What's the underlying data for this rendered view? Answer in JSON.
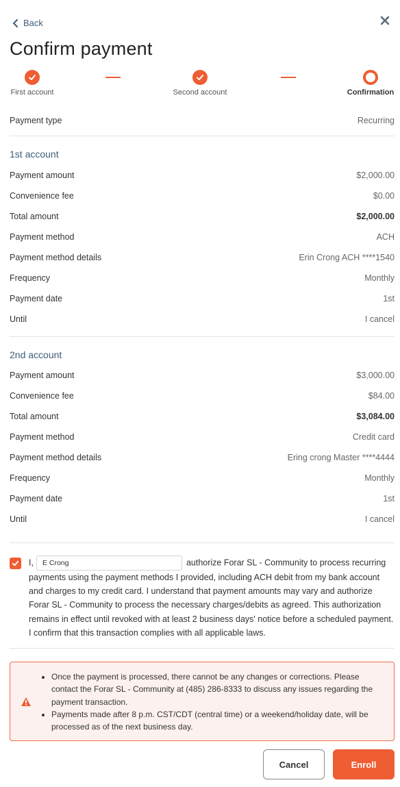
{
  "nav": {
    "back_label": "Back"
  },
  "page_title": "Confirm payment",
  "steps": [
    {
      "label": "First account"
    },
    {
      "label": "Second account"
    },
    {
      "label": "Confirmation"
    }
  ],
  "payment_type": {
    "label": "Payment type",
    "value": "Recurring"
  },
  "accounts": [
    {
      "title": "1st account",
      "rows": [
        {
          "label": "Payment amount",
          "value": "$2,000.00"
        },
        {
          "label": "Convenience fee",
          "value": "$0.00"
        },
        {
          "label": "Total amount",
          "value": "$2,000.00"
        },
        {
          "label": "Payment method",
          "value": "ACH"
        },
        {
          "label": "Payment method details",
          "value": "Erin Crong ACH ****1540"
        },
        {
          "label": "Frequency",
          "value": "Monthly"
        },
        {
          "label": "Payment date",
          "value": "1st"
        },
        {
          "label": "Until",
          "value": "I cancel"
        }
      ]
    },
    {
      "title": "2nd account",
      "rows": [
        {
          "label": "Payment amount",
          "value": "$3,000.00"
        },
        {
          "label": "Convenience fee",
          "value": "$84.00"
        },
        {
          "label": "Total amount",
          "value": "$3,084.00"
        },
        {
          "label": "Payment method",
          "value": "Credit card"
        },
        {
          "label": "Payment method details",
          "value": "Ering crong Master ****4444"
        },
        {
          "label": "Frequency",
          "value": "Monthly"
        },
        {
          "label": "Payment date",
          "value": "1st"
        },
        {
          "label": "Until",
          "value": "I cancel"
        }
      ]
    }
  ],
  "consent": {
    "checked": true,
    "prefix": "I,",
    "name_value": "E Crong",
    "text": "authorize Forar SL - Community to process recurring payments using the payment methods I provided, including ACH debit from my bank account and charges to my credit card. I understand that payment amounts may vary and authorize Forar SL - Community to process the necessary charges/debits as agreed. This authorization remains in effect until revoked with at least 2 business days' notice before a scheduled payment. I confirm that this transaction complies with all applicable laws."
  },
  "alert": {
    "items": [
      "Once the payment is processed, there cannot be any changes or corrections. Please contact the Forar SL - Community at (485) 286-8333 to discuss any issues regarding the payment transaction.",
      "Payments made after 8 p.m. CST/CDT (central time) or a weekend/holiday date, will be processed as of the next business day."
    ]
  },
  "buttons": {
    "cancel": "Cancel",
    "enroll": "Enroll"
  },
  "colors": {
    "accent": "#ef5d32",
    "link": "#3f5d78",
    "alert_bg": "#fdf1ef"
  }
}
